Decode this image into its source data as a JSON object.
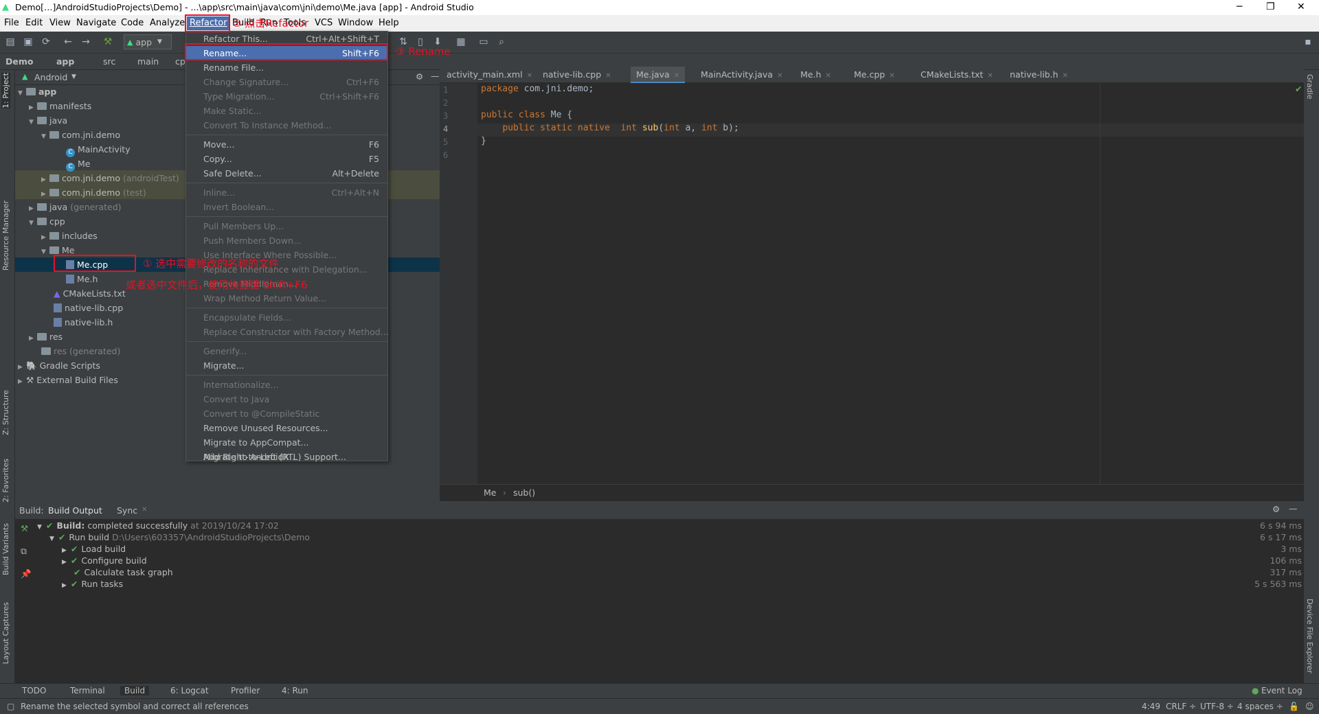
{
  "titlebar": {
    "title": "Demo[…]AndroidStudioProjects\\Demo] - ...\\app\\src\\main\\java\\com\\jni\\demo\\Me.java [app] - Android Studio",
    "minimize": "─",
    "restore": "❐",
    "close": "✕"
  },
  "menubar": {
    "items": [
      "File",
      "Edit",
      "View",
      "Navigate",
      "Code",
      "Analyze",
      "Refactor",
      "Build",
      "Run",
      "Tools",
      "VCS",
      "Window",
      "Help"
    ]
  },
  "toolbar": {
    "run_config": "app"
  },
  "navbar": {
    "crumbs": [
      "Demo",
      "app",
      "src",
      "main",
      "cp"
    ]
  },
  "project": {
    "view": "Android",
    "tree": [
      {
        "label": "app"
      },
      {
        "label": "manifests"
      },
      {
        "label": "java"
      },
      {
        "label": "com.jni.demo"
      },
      {
        "label": "MainActivity"
      },
      {
        "label": "Me"
      },
      {
        "label": "com.jni.demo",
        "suffix": "(androidTest)"
      },
      {
        "label": "com.jni.demo",
        "suffix": "(test)"
      },
      {
        "label": "java",
        "suffix": "(generated)"
      },
      {
        "label": "cpp"
      },
      {
        "label": "includes"
      },
      {
        "label": "Me"
      },
      {
        "label": "Me.cpp"
      },
      {
        "label": "Me.h"
      },
      {
        "label": "CMakeLists.txt"
      },
      {
        "label": "native-lib.cpp"
      },
      {
        "label": "native-lib.h"
      },
      {
        "label": "res"
      },
      {
        "label": "res (generated)"
      },
      {
        "label": "Gradle Scripts"
      },
      {
        "label": "External Build Files"
      }
    ]
  },
  "side_tabs": {
    "project": "1: Project",
    "resource": "Resource Manager",
    "structure": "Z: Structure",
    "favorites": "2: Favorites",
    "variants": "Build Variants",
    "captures": "Layout Captures",
    "gradle": "Gradle",
    "device": "Device File Explorer"
  },
  "editor_tabs": [
    "activity_main.xml",
    "native-lib.cpp",
    "Me.java",
    "MainActivity.java",
    "Me.h",
    "Me.cpp",
    "CMakeLists.txt",
    "native-lib.h"
  ],
  "code": {
    "line_numbers": [
      "1",
      "2",
      "3",
      "4",
      "5",
      "6"
    ]
  },
  "breadcrumb": {
    "a": "Me",
    "sep": "›",
    "b": "sub()"
  },
  "refactor_menu": {
    "items": [
      {
        "label": "Refactor This...",
        "shortcut": "Ctrl+Alt+Shift+T"
      },
      {
        "label": "Rename...",
        "shortcut": "Shift+F6"
      },
      {
        "label": "Rename File...",
        "shortcut": ""
      },
      {
        "label": "Change Signature...",
        "shortcut": "Ctrl+F6"
      },
      {
        "label": "Type Migration...",
        "shortcut": "Ctrl+Shift+F6"
      },
      {
        "label": "Make Static...",
        "shortcut": ""
      },
      {
        "label": "Convert To Instance Method...",
        "shortcut": ""
      },
      {
        "label": "Move...",
        "shortcut": "F6"
      },
      {
        "label": "Copy...",
        "shortcut": "F5"
      },
      {
        "label": "Safe Delete...",
        "shortcut": "Alt+Delete"
      },
      {
        "label": "Inline...",
        "shortcut": "Ctrl+Alt+N"
      },
      {
        "label": "Invert Boolean...",
        "shortcut": ""
      },
      {
        "label": "Pull Members Up...",
        "shortcut": ""
      },
      {
        "label": "Push Members Down...",
        "shortcut": ""
      },
      {
        "label": "Use Interface Where Possible...",
        "shortcut": ""
      },
      {
        "label": "Replace Inheritance with Delegation...",
        "shortcut": ""
      },
      {
        "label": "Remove Middleman...",
        "shortcut": ""
      },
      {
        "label": "Wrap Method Return Value...",
        "shortcut": ""
      },
      {
        "label": "Encapsulate Fields...",
        "shortcut": ""
      },
      {
        "label": "Replace Constructor with Factory Method...",
        "shortcut": ""
      },
      {
        "label": "Generify...",
        "shortcut": ""
      },
      {
        "label": "Migrate...",
        "shortcut": ""
      },
      {
        "label": "Internationalize...",
        "shortcut": ""
      },
      {
        "label": "Convert to Java",
        "shortcut": ""
      },
      {
        "label": "Convert to @CompileStatic",
        "shortcut": ""
      },
      {
        "label": "Remove Unused Resources...",
        "shortcut": ""
      },
      {
        "label": "Migrate to AppCompat...",
        "shortcut": ""
      },
      {
        "label": "Migrate to AndroidX...",
        "shortcut": ""
      },
      {
        "label": "Add Right-to-Left (RTL) Support...",
        "shortcut": ""
      }
    ]
  },
  "annotations": {
    "step1": "① 选中需要修改的名称的文件",
    "step1b": "或者选中文件后，使用快捷键 Shift+F6",
    "step2": "② 点击Refactor",
    "step3": "③ Rename"
  },
  "build": {
    "label": "Build:",
    "tabs": [
      "Build Output",
      "Sync"
    ],
    "lines": [
      {
        "bold": "Build:",
        "text": " completed successfully",
        "extra": " at 2019/10/24 17:02",
        "time": "6 s 94 ms"
      },
      {
        "text": "Run build",
        "extra": " D:\\Users\\603357\\AndroidStudioProjects\\Demo",
        "time": "6 s 17 ms"
      },
      {
        "text": "Load build",
        "time": "3 ms"
      },
      {
        "text": "Configure build",
        "time": "106 ms"
      },
      {
        "text": "Calculate task graph",
        "time": "317 ms"
      },
      {
        "text": "Run tasks",
        "time": "5 s 563 ms"
      }
    ]
  },
  "bottom_tabs": [
    "TODO",
    "Terminal",
    "Build",
    "6: Logcat",
    "Profiler",
    "4: Run",
    "Event Log"
  ],
  "status": {
    "message": "Rename the selected symbol and correct all references",
    "position": "4:49",
    "line_sep": "CRLF ÷",
    "encoding": "UTF-8 ÷",
    "indent": "4 spaces ÷"
  },
  "colors": {
    "accent": "#4b6eaf",
    "annotation": "#e81123",
    "success": "#5ea85e"
  }
}
